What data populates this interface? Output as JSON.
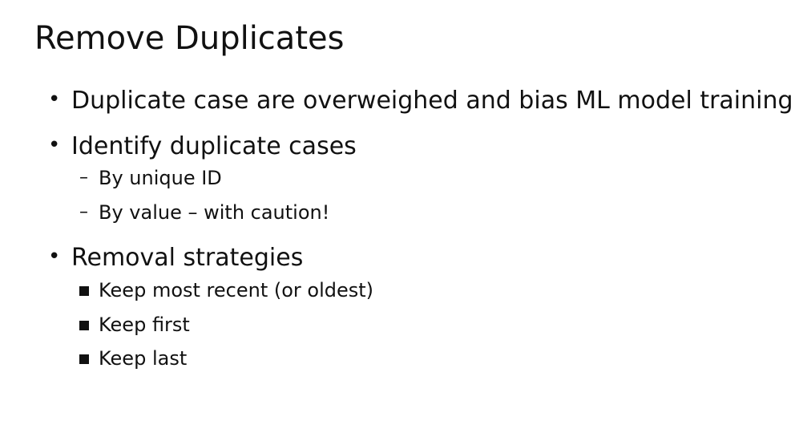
{
  "slide": {
    "title": "Remove Duplicates",
    "items": [
      {
        "text": "Duplicate case are overweighed and bias ML model training"
      },
      {
        "text": "Identify duplicate cases",
        "subitems": [
          {
            "marker": "–",
            "text": "By unique ID"
          },
          {
            "marker": "–",
            "text": "By value – with caution!"
          }
        ]
      },
      {
        "text": "Removal strategies",
        "subitems": [
          {
            "text": "Keep most recent (or oldest)"
          },
          {
            "text": "Keep first"
          },
          {
            "text": "Keep last"
          }
        ]
      }
    ],
    "bullet_marker": "•"
  }
}
